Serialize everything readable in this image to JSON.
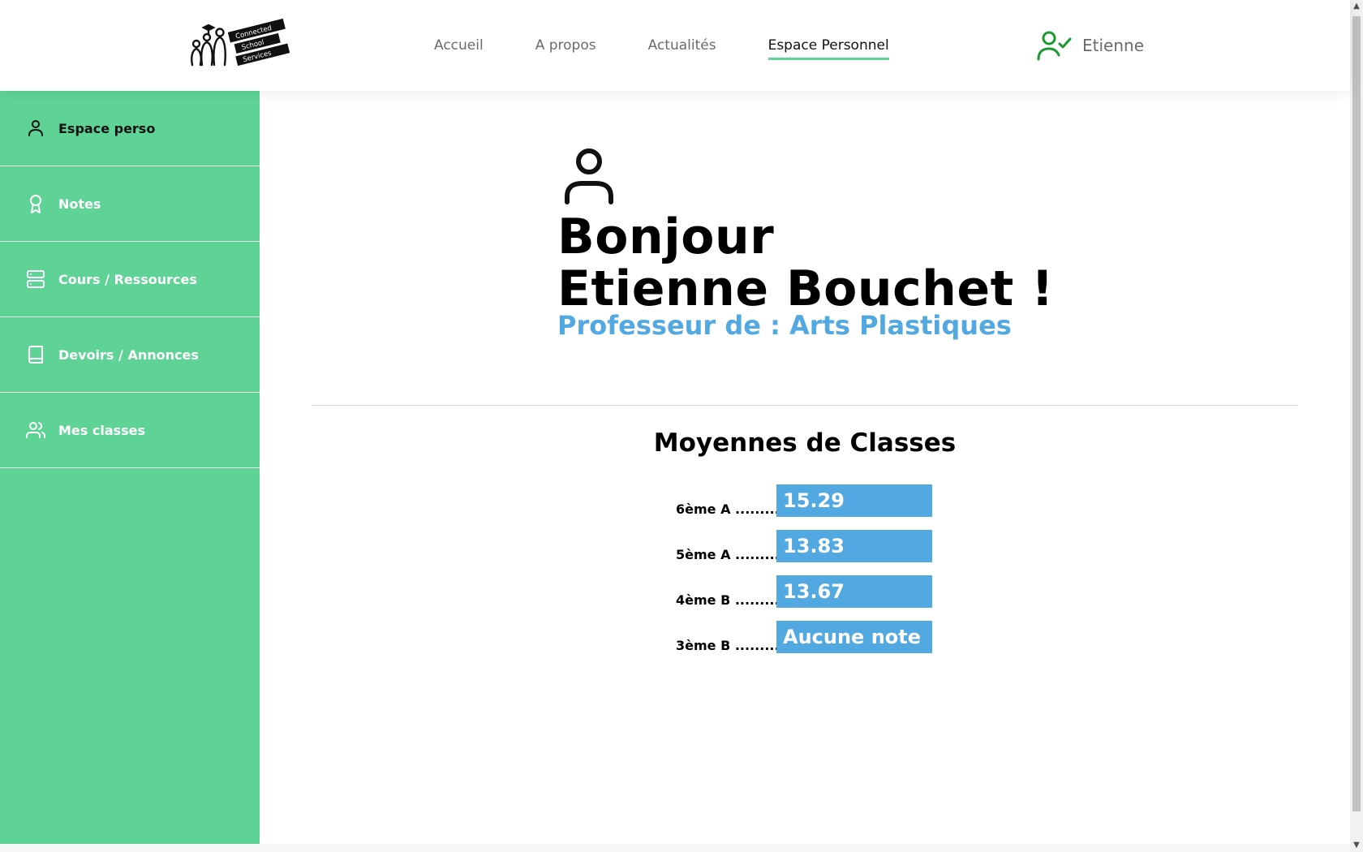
{
  "header": {
    "logo_lines": [
      "Connected",
      "School",
      "Services"
    ],
    "nav": [
      {
        "label": "Accueil",
        "active": false
      },
      {
        "label": "A propos",
        "active": false
      },
      {
        "label": "Actualités",
        "active": false
      },
      {
        "label": "Espace Personnel",
        "active": true
      }
    ],
    "user_icon": "user-check-icon",
    "user_name": "Etienne"
  },
  "sidebar": {
    "items": [
      {
        "label": "Espace perso",
        "icon": "user-icon",
        "active": true
      },
      {
        "label": "Notes",
        "icon": "award-icon",
        "active": false
      },
      {
        "label": "Cours / Ressources",
        "icon": "server-icon",
        "active": false
      },
      {
        "label": "Devoirs / Annonces",
        "icon": "book-icon",
        "active": false
      },
      {
        "label": "Mes classes",
        "icon": "users-icon",
        "active": false
      }
    ]
  },
  "main": {
    "greeting_line1": "Bonjour",
    "greeting_line2": "Etienne Bouchet !",
    "role": "Professeur de : Arts Plastiques",
    "averages_title": "Moyennes de Classes",
    "averages": [
      {
        "label": "6ème A ...........",
        "value": "15.29"
      },
      {
        "label": "5ème A ...........",
        "value": "13.83"
      },
      {
        "label": "4ème B ...........",
        "value": "13.67"
      },
      {
        "label": "3ème B ...........",
        "value": "Aucune note"
      }
    ]
  },
  "colors": {
    "sidebar_green": "#5fd395",
    "accent_blue": "#52a8e0",
    "user_icon_green": "#1a9a2e",
    "nav_underline": "#5fd395"
  }
}
